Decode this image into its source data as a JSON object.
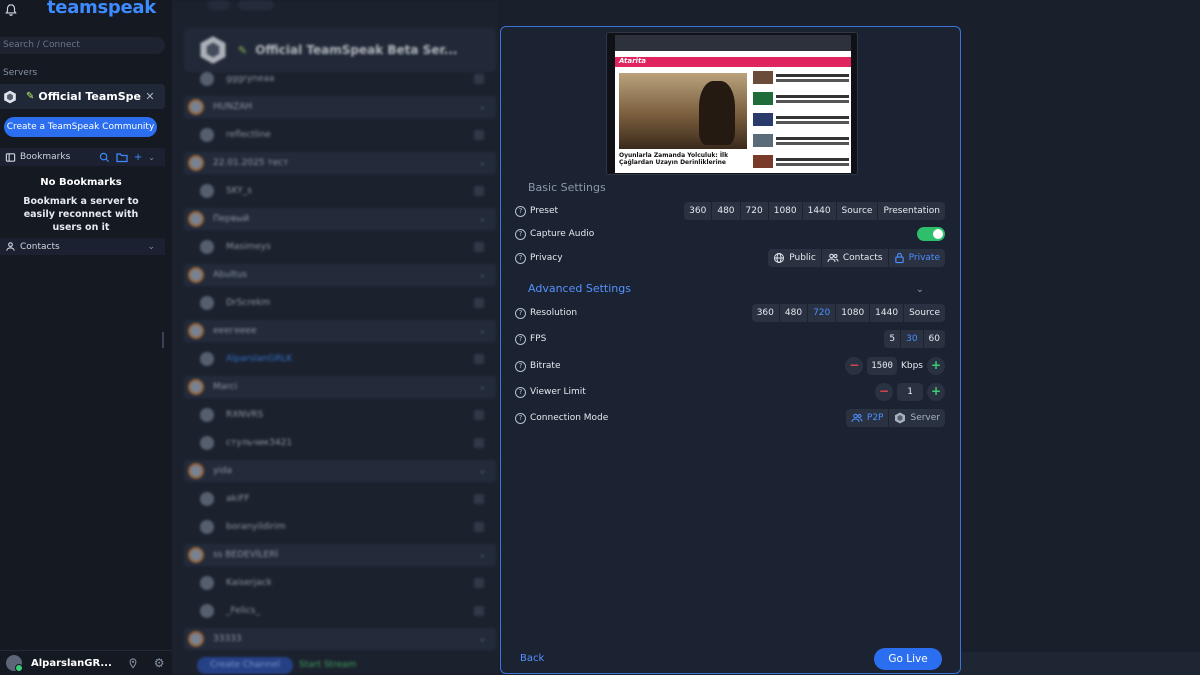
{
  "app": {
    "logo": "teamspeak",
    "search_placeholder": "Search / Connect",
    "servers_label": "Servers",
    "server_name": "Official TeamSpeak ...",
    "create_community": "Create a TeamSpeak Community",
    "bookmarks_label": "Bookmarks",
    "no_bookmarks_title": "No Bookmarks",
    "no_bookmarks_desc": "Bookmark a server to easily reconnect with users on it",
    "contacts_label": "Contacts",
    "username": "AlparslanGR..."
  },
  "channels": {
    "server_title": "Official TeamSpeak Beta Ser...",
    "rows": [
      {
        "kind": "user",
        "label": "gggryneaa"
      },
      {
        "kind": "group",
        "label": "HUNZAH"
      },
      {
        "kind": "user",
        "label": "reflectline"
      },
      {
        "kind": "group",
        "label": "22.01.2025 тест"
      },
      {
        "kind": "user",
        "label": "SKY_s"
      },
      {
        "kind": "group",
        "label": "Первый"
      },
      {
        "kind": "user",
        "label": "Masimeys"
      },
      {
        "kind": "group",
        "label": "Abultus"
      },
      {
        "kind": "user",
        "label": "DrScrekm"
      },
      {
        "kind": "group",
        "label": "ееегееее"
      },
      {
        "kind": "user",
        "label": "AlparslanGRLK"
      },
      {
        "kind": "group",
        "label": "Marci"
      },
      {
        "kind": "user",
        "label": "RXNVRS"
      },
      {
        "kind": "user",
        "label": "стульчик3421"
      },
      {
        "kind": "group",
        "label": "yida"
      },
      {
        "kind": "user",
        "label": "akiFF"
      },
      {
        "kind": "user",
        "label": "boranyildirim"
      },
      {
        "kind": "group",
        "label": "ss BEDEVİLERİ"
      },
      {
        "kind": "user",
        "label": "Kaiserjack"
      },
      {
        "kind": "user",
        "label": "_Felics_"
      },
      {
        "kind": "group",
        "label": "33333"
      }
    ],
    "create_channel": "Create Channel",
    "start_stream": "Start Stream"
  },
  "preview": {
    "site_logo": "Atarita",
    "headline": "Oyunlarla Zamanda Yolculuk: İlk Çağlardan Uzayın Derinliklerine"
  },
  "modal": {
    "basic_title": "Basic Settings",
    "advanced_title": "Advanced Settings",
    "preset": {
      "label": "Preset",
      "options": [
        "360",
        "480",
        "720",
        "1080",
        "1440",
        "Source",
        "Presentation"
      ]
    },
    "capture_audio": {
      "label": "Capture Audio",
      "enabled": true
    },
    "privacy": {
      "label": "Privacy",
      "options": [
        "Public",
        "Contacts",
        "Private"
      ],
      "selected": "Private"
    },
    "resolution": {
      "label": "Resolution",
      "options": [
        "360",
        "480",
        "720",
        "1080",
        "1440",
        "Source"
      ],
      "selected": "720"
    },
    "fps": {
      "label": "FPS",
      "options": [
        "5",
        "30",
        "60"
      ],
      "selected": "30"
    },
    "bitrate": {
      "label": "Bitrate",
      "value": "1500",
      "unit": "Kbps"
    },
    "viewer_limit": {
      "label": "Viewer Limit",
      "value": "1"
    },
    "connection_mode": {
      "label": "Connection Mode",
      "options": [
        "P2P",
        "Server"
      ],
      "selected": "P2P"
    },
    "back": "Back",
    "go_live": "Go Live"
  },
  "colors": {
    "accent": "#2b6ff0",
    "selected_text": "#4b8dff",
    "toggle_on": "#2fbf6a",
    "minus": "#e04848",
    "plus": "#3ccf73"
  }
}
